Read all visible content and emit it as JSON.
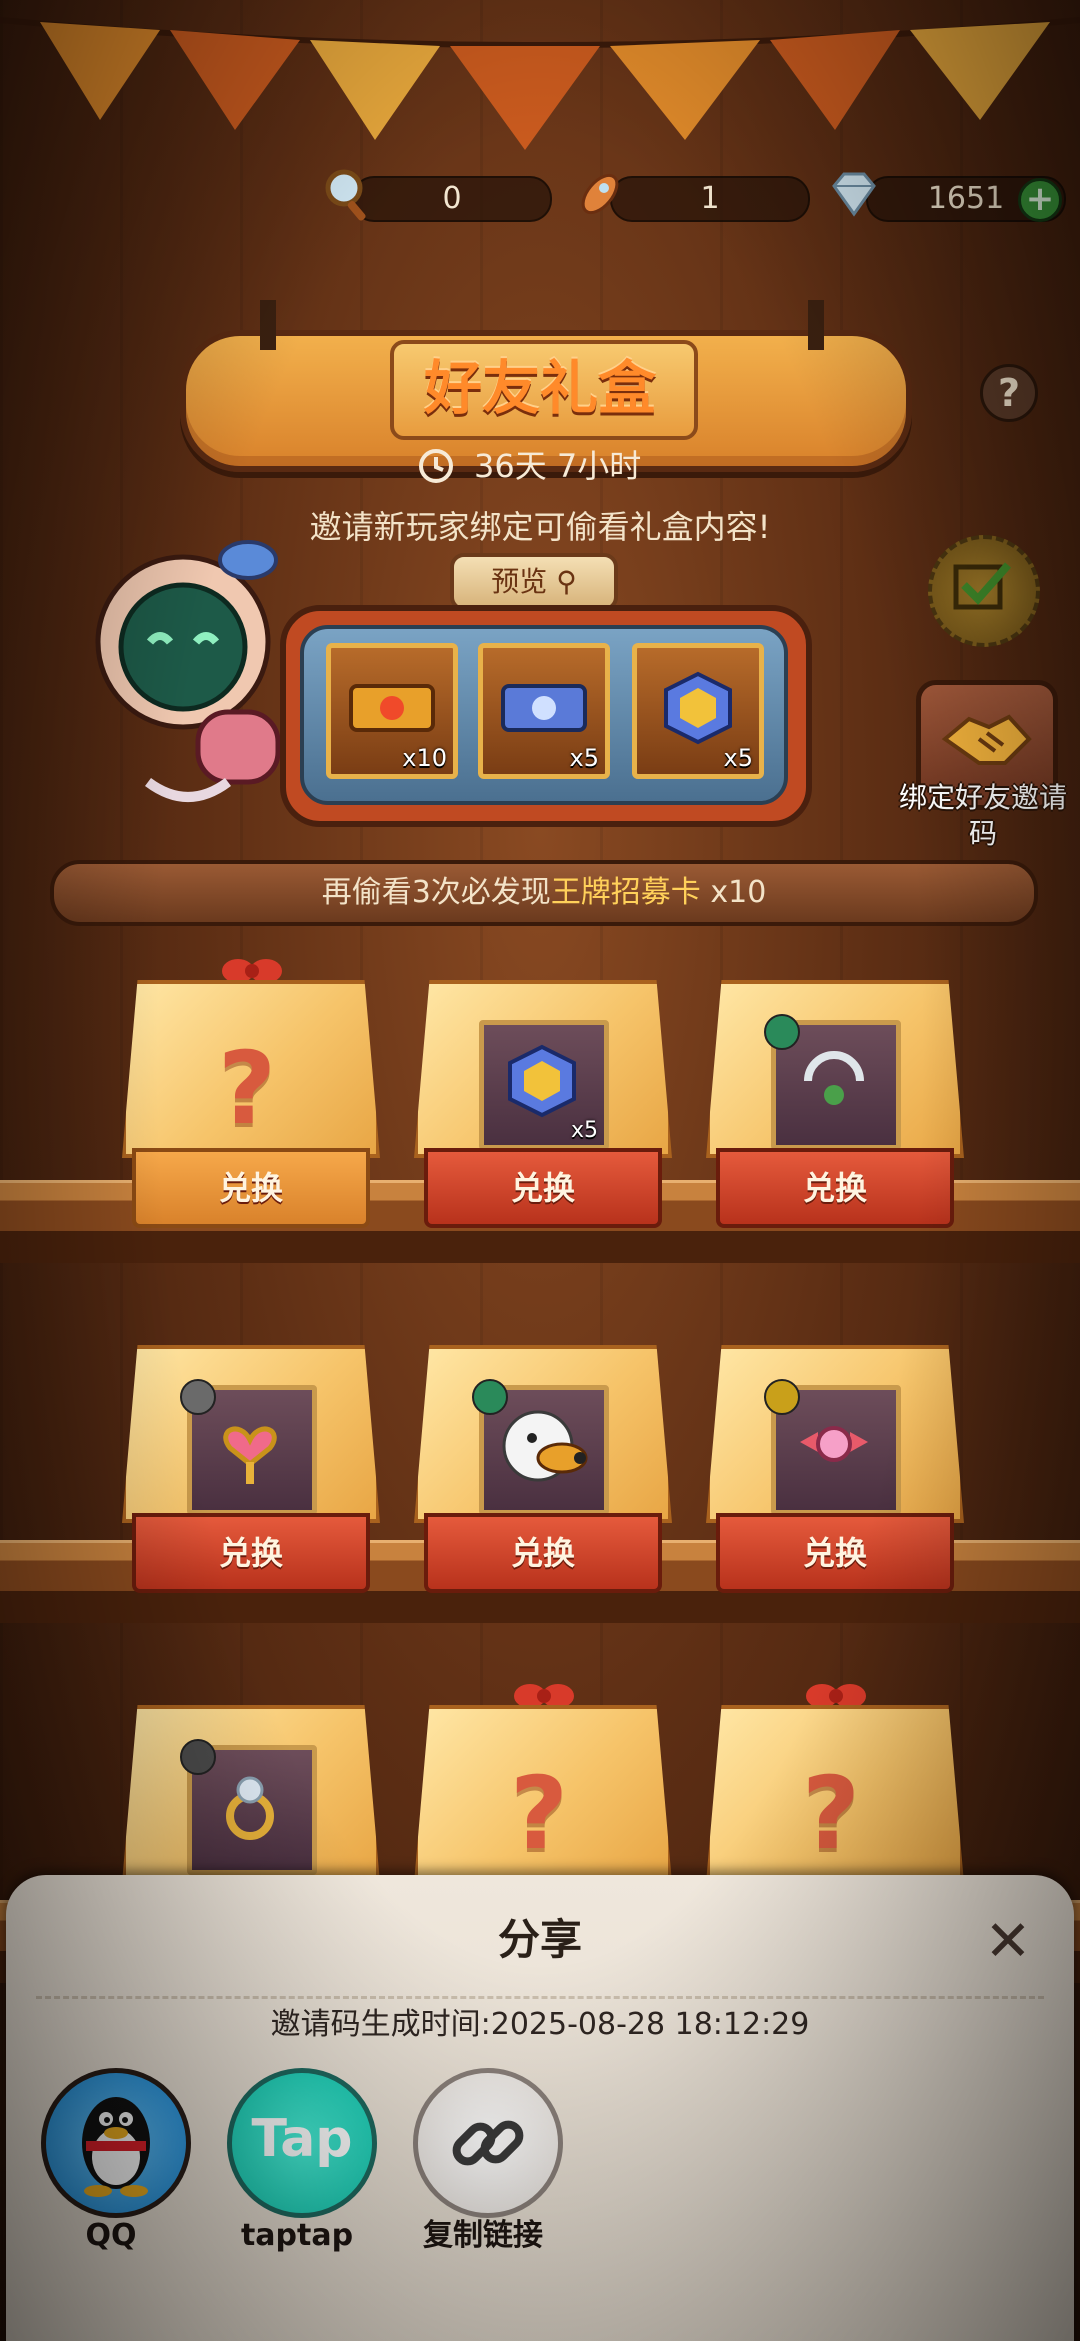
{
  "currency": [
    {
      "icon": "magnifier-icon",
      "value": "0"
    },
    {
      "icon": "rocket-icon",
      "value": "1"
    },
    {
      "icon": "diamond-icon",
      "value": "1651"
    }
  ],
  "header": {
    "title": "好友礼盒",
    "timer": "36天  7小时",
    "subtitle": "邀请新玩家绑定可偷看礼盒内容!",
    "help_label": "?"
  },
  "preview": {
    "tag": "预览",
    "items": [
      {
        "icon": "gold-ticket-icon",
        "count": "x10"
      },
      {
        "icon": "blue-ticket-icon",
        "count": "x5"
      },
      {
        "icon": "mystery-cube-icon",
        "count": "x5"
      }
    ]
  },
  "side": {
    "bind_label": "绑定好友邀请码"
  },
  "progress": {
    "prefix": "再偷看3次必发现",
    "highlight": "王牌招募卡",
    "suffix": " x10"
  },
  "boxes": {
    "redeem_label": "兑换",
    "rows": [
      [
        {
          "type": "unknown",
          "icon": "question-mark-icon"
        },
        {
          "type": "item",
          "icon": "mystery-cube-icon",
          "count": "x5"
        },
        {
          "type": "item",
          "icon": "ring-handle-icon",
          "count": ""
        }
      ],
      [
        {
          "type": "item",
          "icon": "heart-wand-icon",
          "count": ""
        },
        {
          "type": "item",
          "icon": "duck-character-icon",
          "count": ""
        },
        {
          "type": "item",
          "icon": "pink-gem-icon",
          "count": ""
        }
      ],
      [
        {
          "type": "item",
          "icon": "diamond-ring-icon",
          "count": ""
        },
        {
          "type": "unknown",
          "icon": "question-mark-icon"
        },
        {
          "type": "unknown",
          "icon": "question-mark-icon"
        }
      ]
    ]
  },
  "share": {
    "title": "分享",
    "close_label": "✕",
    "invite_time": "邀请码生成时间:2025-08-28  18:12:29",
    "options": [
      {
        "label": "QQ",
        "icon": "qq-penguin-icon"
      },
      {
        "label": "taptap",
        "icon": "taptap-logo-icon",
        "logo_text": "Tap"
      },
      {
        "label": "复制链接",
        "icon": "link-icon"
      }
    ]
  },
  "colors": {
    "wood_dark": "#5d2e14",
    "accent_orange": "#f2b04c",
    "redeem_red": "#e55a3c",
    "sheet_bg": "#efe7dc"
  }
}
